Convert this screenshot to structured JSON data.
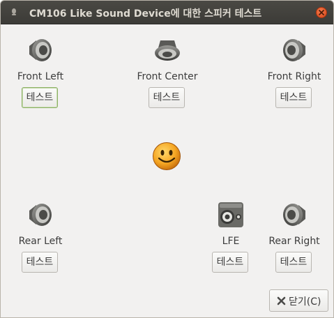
{
  "window": {
    "title": "CM106 Like Sound Device에 대한 스피커 테스트"
  },
  "channels": [
    {
      "id": "front-left",
      "label": "Front Left",
      "button": "테스트",
      "icon": "speaker-left-icon"
    },
    {
      "id": "front-center",
      "label": "Front Center",
      "button": "테스트",
      "icon": "speaker-center-icon"
    },
    {
      "id": "front-right",
      "label": "Front Right",
      "button": "테스트",
      "icon": "speaker-right-icon"
    },
    {
      "id": "rear-left",
      "label": "Rear Left",
      "button": "테스트",
      "icon": "speaker-left-icon"
    },
    {
      "id": "lfe",
      "label": "LFE",
      "button": "테스트",
      "icon": "subwoofer-icon"
    },
    {
      "id": "rear-right",
      "label": "Rear Right",
      "button": "테스트",
      "icon": "speaker-right-icon"
    }
  ],
  "listener_icon": "smiley-face-icon",
  "footer": {
    "close_label": "닫기(C)"
  },
  "colors": {
    "titlebar": "#3c3b37",
    "close_button": "#e0511e",
    "focus_border": "#8bb063"
  }
}
